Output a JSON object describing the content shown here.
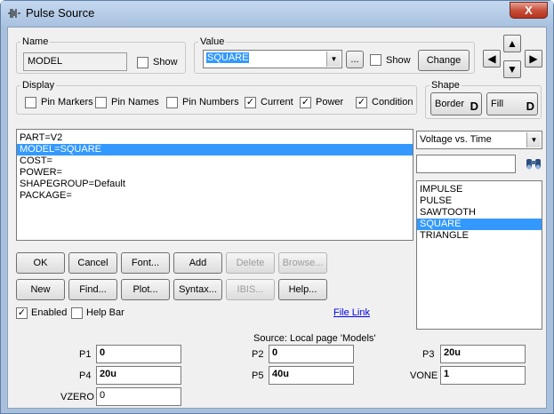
{
  "window": {
    "title": "Pulse Source",
    "close_label": "X"
  },
  "name_group": {
    "legend": "Name",
    "value": "MODEL",
    "show_label": "Show",
    "show_checked": false
  },
  "value_group": {
    "legend": "Value",
    "value": "SQUARE",
    "ellipsis_label": "...",
    "show_label": "Show",
    "show_checked": false,
    "change_label": "Change"
  },
  "display_group": {
    "legend": "Display",
    "items": [
      {
        "label": "Pin Markers",
        "checked": false
      },
      {
        "label": "Pin Names",
        "checked": false
      },
      {
        "label": "Pin Numbers",
        "checked": false
      },
      {
        "label": "Current",
        "checked": true
      },
      {
        "label": "Power",
        "checked": true
      },
      {
        "label": "Condition",
        "checked": true
      }
    ]
  },
  "shape_group": {
    "legend": "Shape",
    "border_label": "Border",
    "fill_label": "Fill",
    "icon_glyph": "D"
  },
  "attributes": {
    "lines": [
      "PART=V2",
      "MODEL=SQUARE",
      "COST=",
      "POWER=",
      "SHAPEGROUP=Default",
      "PACKAGE="
    ],
    "selected_index": 1
  },
  "right_panel": {
    "plot_select": "Voltage vs. Time",
    "search_value": "",
    "models": [
      "IMPULSE",
      "PULSE",
      "SAWTOOTH",
      "SQUARE",
      "TRIANGLE"
    ],
    "selected_model_index": 3
  },
  "buttons_row1": {
    "ok": "OK",
    "cancel": "Cancel",
    "font": "Font...",
    "add": "Add",
    "delete": "Delete",
    "browse": "Browse..."
  },
  "buttons_row2": {
    "new": "New",
    "find": "Find...",
    "plot": "Plot...",
    "syntax": "Syntax...",
    "ibis": "IBIS...",
    "help": "Help..."
  },
  "options": {
    "enabled_label": "Enabled",
    "enabled_checked": true,
    "helpbar_label": "Help Bar",
    "helpbar_checked": false
  },
  "file_link": "File Link",
  "params": {
    "source": "Source: Local page 'Models'",
    "p1_label": "P1",
    "p1": "0",
    "p2_label": "P2",
    "p2": "0",
    "p3_label": "P3",
    "p3": "20u",
    "p4_label": "P4",
    "p4": "20u",
    "p5_label": "P5",
    "p5": "40u",
    "vone_label": "VONE",
    "vone": "1",
    "vzero_label": "VZERO",
    "vzero": "0"
  }
}
